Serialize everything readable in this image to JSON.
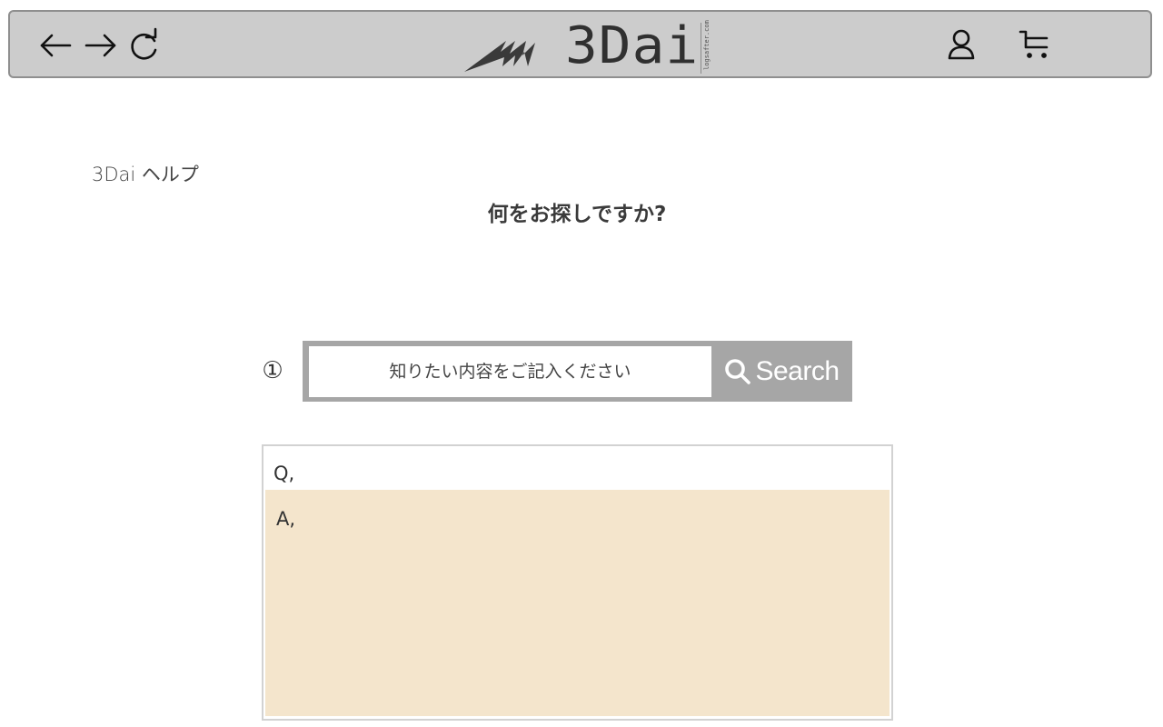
{
  "header": {
    "logo_text": "3Dai",
    "logo_tagline": "logsafter.com",
    "nav": {
      "back_icon": "arrow-left-icon",
      "forward_icon": "arrow-right-icon",
      "reload_icon": "reload-icon",
      "account_icon": "user-icon",
      "cart_icon": "cart-icon"
    }
  },
  "page": {
    "help_title": "3Dai ヘルプ",
    "heading": "何をお探しですか?"
  },
  "search": {
    "step_number": "①",
    "placeholder": "知りたい内容をご記入ください",
    "value": "",
    "button_label": "Search",
    "button_icon": "search-icon"
  },
  "faq": {
    "question_label": "Q,",
    "answer_label": "A,"
  },
  "colors": {
    "topbar_bg": "#cccccc",
    "search_frame": "#a6a6a6",
    "answer_bg": "#f4e5cc"
  }
}
